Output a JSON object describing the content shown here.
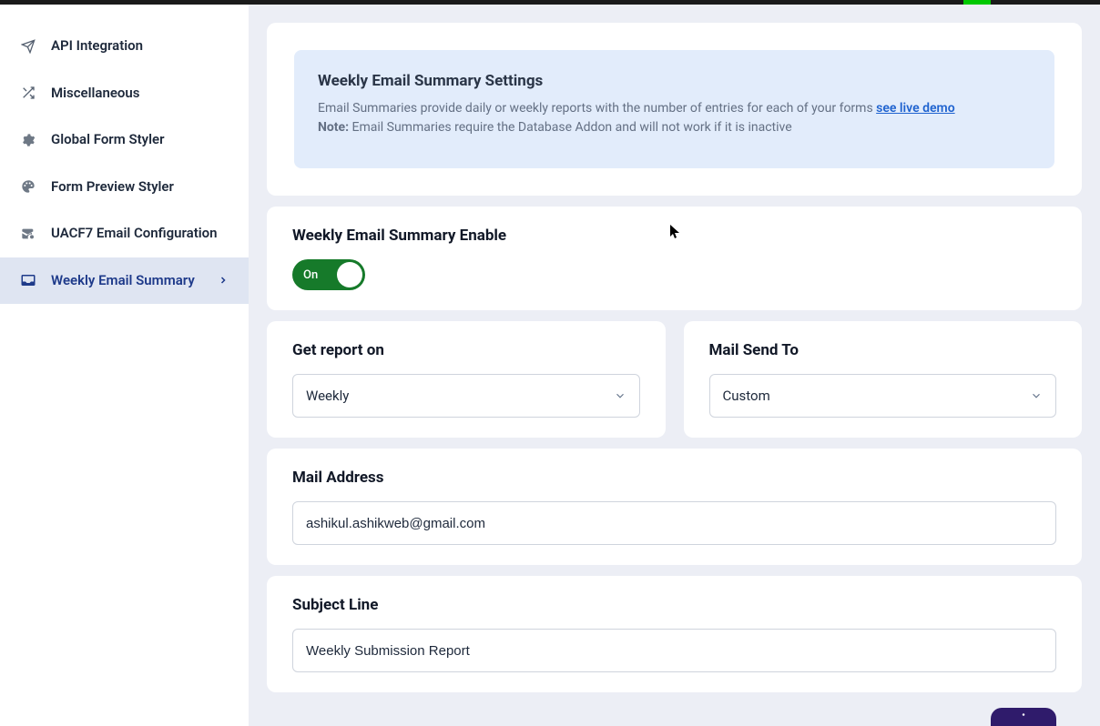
{
  "sidebar": {
    "items": [
      {
        "label": "API Integration",
        "icon": "paper-plane"
      },
      {
        "label": "Miscellaneous",
        "icon": "shuffle"
      },
      {
        "label": "Global Form Styler",
        "icon": "gear"
      },
      {
        "label": "Form Preview Styler",
        "icon": "palette"
      },
      {
        "label": "UACF7 Email Configuration",
        "icon": "envelope-gear"
      },
      {
        "label": "Weekly Email Summary",
        "icon": "inbox",
        "active": true
      }
    ]
  },
  "info": {
    "title": "Weekly Email Summary Settings",
    "desc": "Email Summaries provide daily or weekly reports with the number of entries for each of your forms ",
    "link_text": "see live demo",
    "note_label": "Note:",
    "note_text": " Email Summaries require the Database Addon and will not work if it is inactive"
  },
  "enable": {
    "title": "Weekly Email Summary Enable",
    "toggle_state": "On"
  },
  "report": {
    "title": "Get report on",
    "value": "Weekly"
  },
  "mail_to": {
    "title": "Mail Send To",
    "value": "Custom"
  },
  "mail_address": {
    "title": "Mail Address",
    "value": "ashikul.ashikweb@gmail.com"
  },
  "subject": {
    "title": "Subject Line",
    "value": "Weekly Submission Report"
  }
}
